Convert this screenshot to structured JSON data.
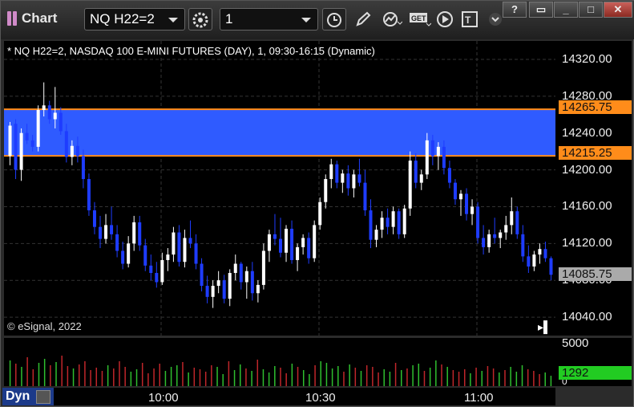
{
  "window": {
    "title": "Chart",
    "symbol_value": "NQ H22=2",
    "interval_value": "1",
    "window_buttons": [
      "?",
      "▭",
      "_",
      "□",
      "✕"
    ]
  },
  "chart": {
    "description": "* NQ H22=2, NASDAQ 100 E-MINI FUTURES (DAY), 1, 09:30-16:15 (Dynamic)",
    "copyright": "© eSignal, 2022",
    "price_ticks": [
      "14320.00",
      "14280.00",
      "14240.00",
      "14200.00",
      "14160.00",
      "14120.00",
      "14080.00",
      "14040.00"
    ],
    "band_high": "14265.75",
    "band_low": "14215.25",
    "last_price": "14085.75",
    "volume_tick": "5000",
    "volume_zero": "0",
    "last_volume": "1292",
    "time_labels": [
      "10:00",
      "10:30",
      "11:00"
    ],
    "mode_label": "Dyn",
    "colors": {
      "up": "#ffffff",
      "down": "#1e3cff",
      "band": "#2f5bff",
      "band_line": "#ff8c1a",
      "vol_up": "#2fbf2f",
      "vol_down": "#c0262a",
      "last_volume_bg": "#22cc22"
    }
  },
  "chart_data": {
    "type": "candlestick",
    "ylim": [
      14020,
      14340
    ],
    "band": [
      14215.25,
      14265.75
    ],
    "candles": [
      [
        14215,
        14252,
        14205,
        14248
      ],
      [
        14250,
        14255,
        14190,
        14200
      ],
      [
        14200,
        14245,
        14188,
        14240
      ],
      [
        14240,
        14250,
        14228,
        14232
      ],
      [
        14232,
        14238,
        14220,
        14225
      ],
      [
        14225,
        14270,
        14220,
        14265
      ],
      [
        14265,
        14295,
        14258,
        14270
      ],
      [
        14270,
        14275,
        14250,
        14255
      ],
      [
        14255,
        14290,
        14245,
        14262
      ],
      [
        14262,
        14268,
        14238,
        14242
      ],
      [
        14242,
        14250,
        14208,
        14214
      ],
      [
        14214,
        14232,
        14205,
        14226
      ],
      [
        14226,
        14236,
        14208,
        14215
      ],
      [
        14215,
        14222,
        14180,
        14190
      ],
      [
        14190,
        14196,
        14150,
        14156
      ],
      [
        14156,
        14165,
        14130,
        14138
      ],
      [
        14138,
        14150,
        14115,
        14125
      ],
      [
        14125,
        14152,
        14120,
        14140
      ],
      [
        14140,
        14160,
        14124,
        14130
      ],
      [
        14130,
        14140,
        14105,
        14112
      ],
      [
        14112,
        14122,
        14092,
        14098
      ],
      [
        14098,
        14128,
        14094,
        14120
      ],
      [
        14120,
        14150,
        14112,
        14143
      ],
      [
        14143,
        14150,
        14112,
        14118
      ],
      [
        14118,
        14125,
        14090,
        14096
      ],
      [
        14096,
        14108,
        14080,
        14088
      ],
      [
        14088,
        14100,
        14072,
        14078
      ],
      [
        14078,
        14110,
        14075,
        14102
      ],
      [
        14102,
        14115,
        14090,
        14108
      ],
      [
        14108,
        14138,
        14100,
        14132
      ],
      [
        14132,
        14140,
        14095,
        14100
      ],
      [
        14100,
        14135,
        14094,
        14126
      ],
      [
        14126,
        14145,
        14115,
        14120
      ],
      [
        14120,
        14130,
        14092,
        14098
      ],
      [
        14098,
        14104,
        14068,
        14074
      ],
      [
        14074,
        14085,
        14055,
        14062
      ],
      [
        14062,
        14080,
        14050,
        14074
      ],
      [
        14074,
        14090,
        14066,
        14080
      ],
      [
        14080,
        14086,
        14055,
        14060
      ],
      [
        14060,
        14092,
        14052,
        14088
      ],
      [
        14088,
        14108,
        14080,
        14098
      ],
      [
        14098,
        14100,
        14070,
        14078
      ],
      [
        14078,
        14095,
        14060,
        14090
      ],
      [
        14090,
        14100,
        14058,
        14066
      ],
      [
        14066,
        14080,
        14056,
        14075
      ],
      [
        14075,
        14120,
        14070,
        14112
      ],
      [
        14112,
        14135,
        14100,
        14130
      ],
      [
        14130,
        14152,
        14118,
        14125
      ],
      [
        14125,
        14148,
        14105,
        14110
      ],
      [
        14110,
        14140,
        14100,
        14136
      ],
      [
        14136,
        14145,
        14098,
        14102
      ],
      [
        14102,
        14120,
        14090,
        14116
      ],
      [
        14116,
        14130,
        14108,
        14126
      ],
      [
        14126,
        14132,
        14098,
        14104
      ],
      [
        14104,
        14145,
        14100,
        14140
      ],
      [
        14140,
        14170,
        14135,
        14165
      ],
      [
        14165,
        14195,
        14158,
        14190
      ],
      [
        14190,
        14212,
        14180,
        14206
      ],
      [
        14206,
        14210,
        14180,
        14186
      ],
      [
        14186,
        14200,
        14175,
        14196
      ],
      [
        14196,
        14205,
        14172,
        14180
      ],
      [
        14180,
        14200,
        14170,
        14195
      ],
      [
        14195,
        14212,
        14182,
        14186
      ],
      [
        14186,
        14200,
        14150,
        14156
      ],
      [
        14156,
        14168,
        14115,
        14124
      ],
      [
        14124,
        14140,
        14116,
        14135
      ],
      [
        14135,
        14155,
        14126,
        14148
      ],
      [
        14148,
        14158,
        14130,
        14138
      ],
      [
        14138,
        14160,
        14130,
        14155
      ],
      [
        14155,
        14158,
        14125,
        14130
      ],
      [
        14130,
        14162,
        14126,
        14158
      ],
      [
        14158,
        14220,
        14150,
        14210
      ],
      [
        14210,
        14218,
        14180,
        14186
      ],
      [
        14186,
        14200,
        14178,
        14195
      ],
      [
        14195,
        14240,
        14190,
        14232
      ],
      [
        14232,
        14238,
        14205,
        14215
      ],
      [
        14215,
        14230,
        14200,
        14225
      ],
      [
        14225,
        14232,
        14195,
        14202
      ],
      [
        14202,
        14210,
        14180,
        14186
      ],
      [
        14186,
        14190,
        14162,
        14168
      ],
      [
        14168,
        14178,
        14150,
        14174
      ],
      [
        14174,
        14180,
        14145,
        14152
      ],
      [
        14152,
        14168,
        14140,
        14160
      ],
      [
        14160,
        14165,
        14120,
        14126
      ],
      [
        14126,
        14140,
        14108,
        14116
      ],
      [
        14116,
        14135,
        14110,
        14130
      ],
      [
        14130,
        14148,
        14120,
        14126
      ],
      [
        14126,
        14135,
        14115,
        14132
      ],
      [
        14132,
        14150,
        14124,
        14140
      ],
      [
        14140,
        14170,
        14130,
        14155
      ],
      [
        14155,
        14160,
        14125,
        14130
      ],
      [
        14130,
        14140,
        14100,
        14106
      ],
      [
        14106,
        14118,
        14088,
        14095
      ],
      [
        14095,
        14112,
        14090,
        14108
      ],
      [
        14108,
        14120,
        14098,
        14114
      ],
      [
        14114,
        14122,
        14100,
        14104
      ],
      [
        14104,
        14106,
        14080,
        14086
      ]
    ],
    "volume_ylim": [
      0,
      6000
    ],
    "volumes": [
      3200,
      2800,
      2400,
      3600,
      2100,
      2900,
      3400,
      2600,
      3000,
      3800,
      2500,
      2200,
      2700,
      3100,
      2000,
      2300,
      1900,
      2600,
      2200,
      3100,
      2400,
      1800,
      2100,
      2900,
      1600,
      2200,
      2800,
      1900,
      2400,
      2600,
      3000,
      1700,
      2300,
      2100,
      1800,
      2600,
      2400,
      1500,
      3100,
      2000,
      2700,
      2200,
      1900,
      3300,
      2100,
      1700,
      2500,
      2300,
      1600,
      2800,
      2400,
      2000,
      1500,
      2600,
      3100,
      2900,
      2200,
      2500,
      1800,
      2700,
      2300,
      1900,
      2600,
      2400,
      1700,
      2100,
      1800,
      2900,
      2000,
      2200,
      2600,
      2800,
      1900,
      2300,
      3200,
      2700,
      2400,
      2000,
      1800,
      2100,
      1600,
      2300,
      1900,
      2500,
      2200,
      1700,
      2000,
      2400,
      1800,
      2600,
      2100,
      1900,
      1500,
      1700,
      1292
    ]
  }
}
